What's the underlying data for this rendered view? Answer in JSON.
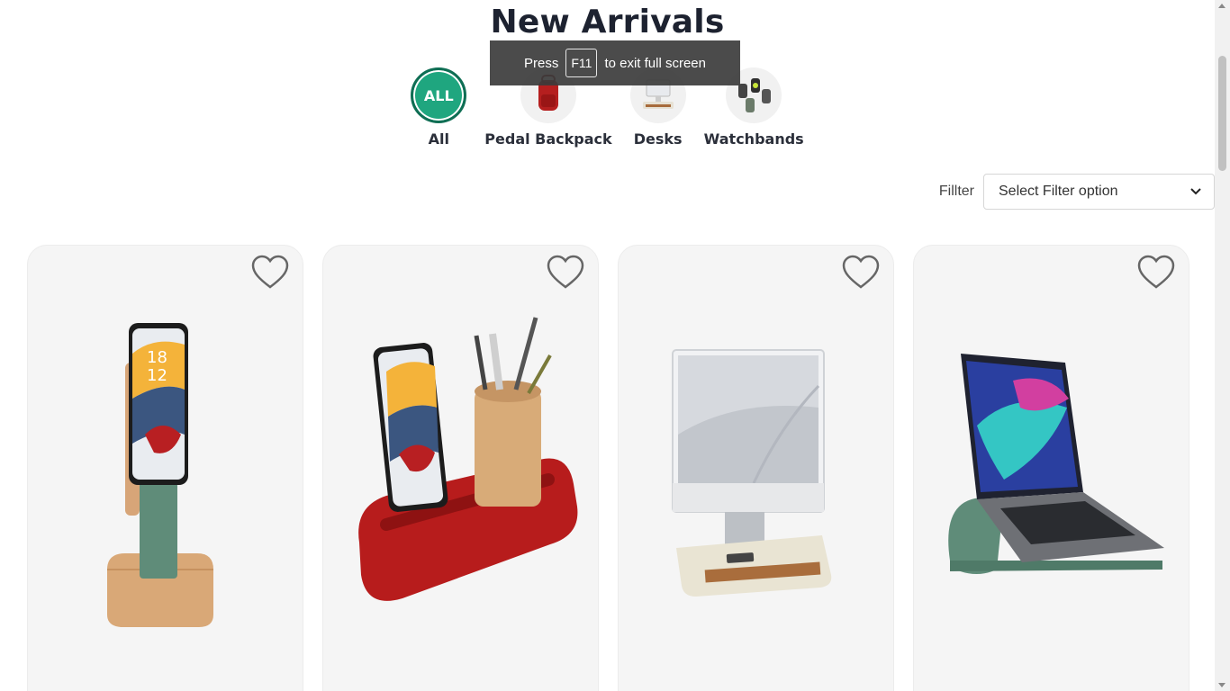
{
  "page": {
    "title": "New Arrivals"
  },
  "toast": {
    "prefix": "Press",
    "key": "F11",
    "suffix": "to exit full screen"
  },
  "categories": [
    {
      "label": "All",
      "badge": "ALL",
      "active": true
    },
    {
      "label": "Pedal Backpack",
      "icon": "backpack-image"
    },
    {
      "label": "Desks",
      "icon": "desk-image"
    },
    {
      "label": "Watchbands",
      "icon": "watchband-image"
    }
  ],
  "filter": {
    "label": "Fillter",
    "selected": "Select Filter option"
  },
  "products": [
    {
      "image": "phone-stand-green-image",
      "wishlist_icon": "heart-icon"
    },
    {
      "image": "red-desk-organizer-image",
      "wishlist_icon": "heart-icon"
    },
    {
      "image": "monitor-stand-image",
      "wishlist_icon": "heart-icon"
    },
    {
      "image": "laptop-stand-image",
      "wishlist_icon": "heart-icon"
    }
  ],
  "colors": {
    "accent": "#1fa67f",
    "card_bg": "#f5f5f5",
    "toast_bg": "#3c3c3c"
  }
}
